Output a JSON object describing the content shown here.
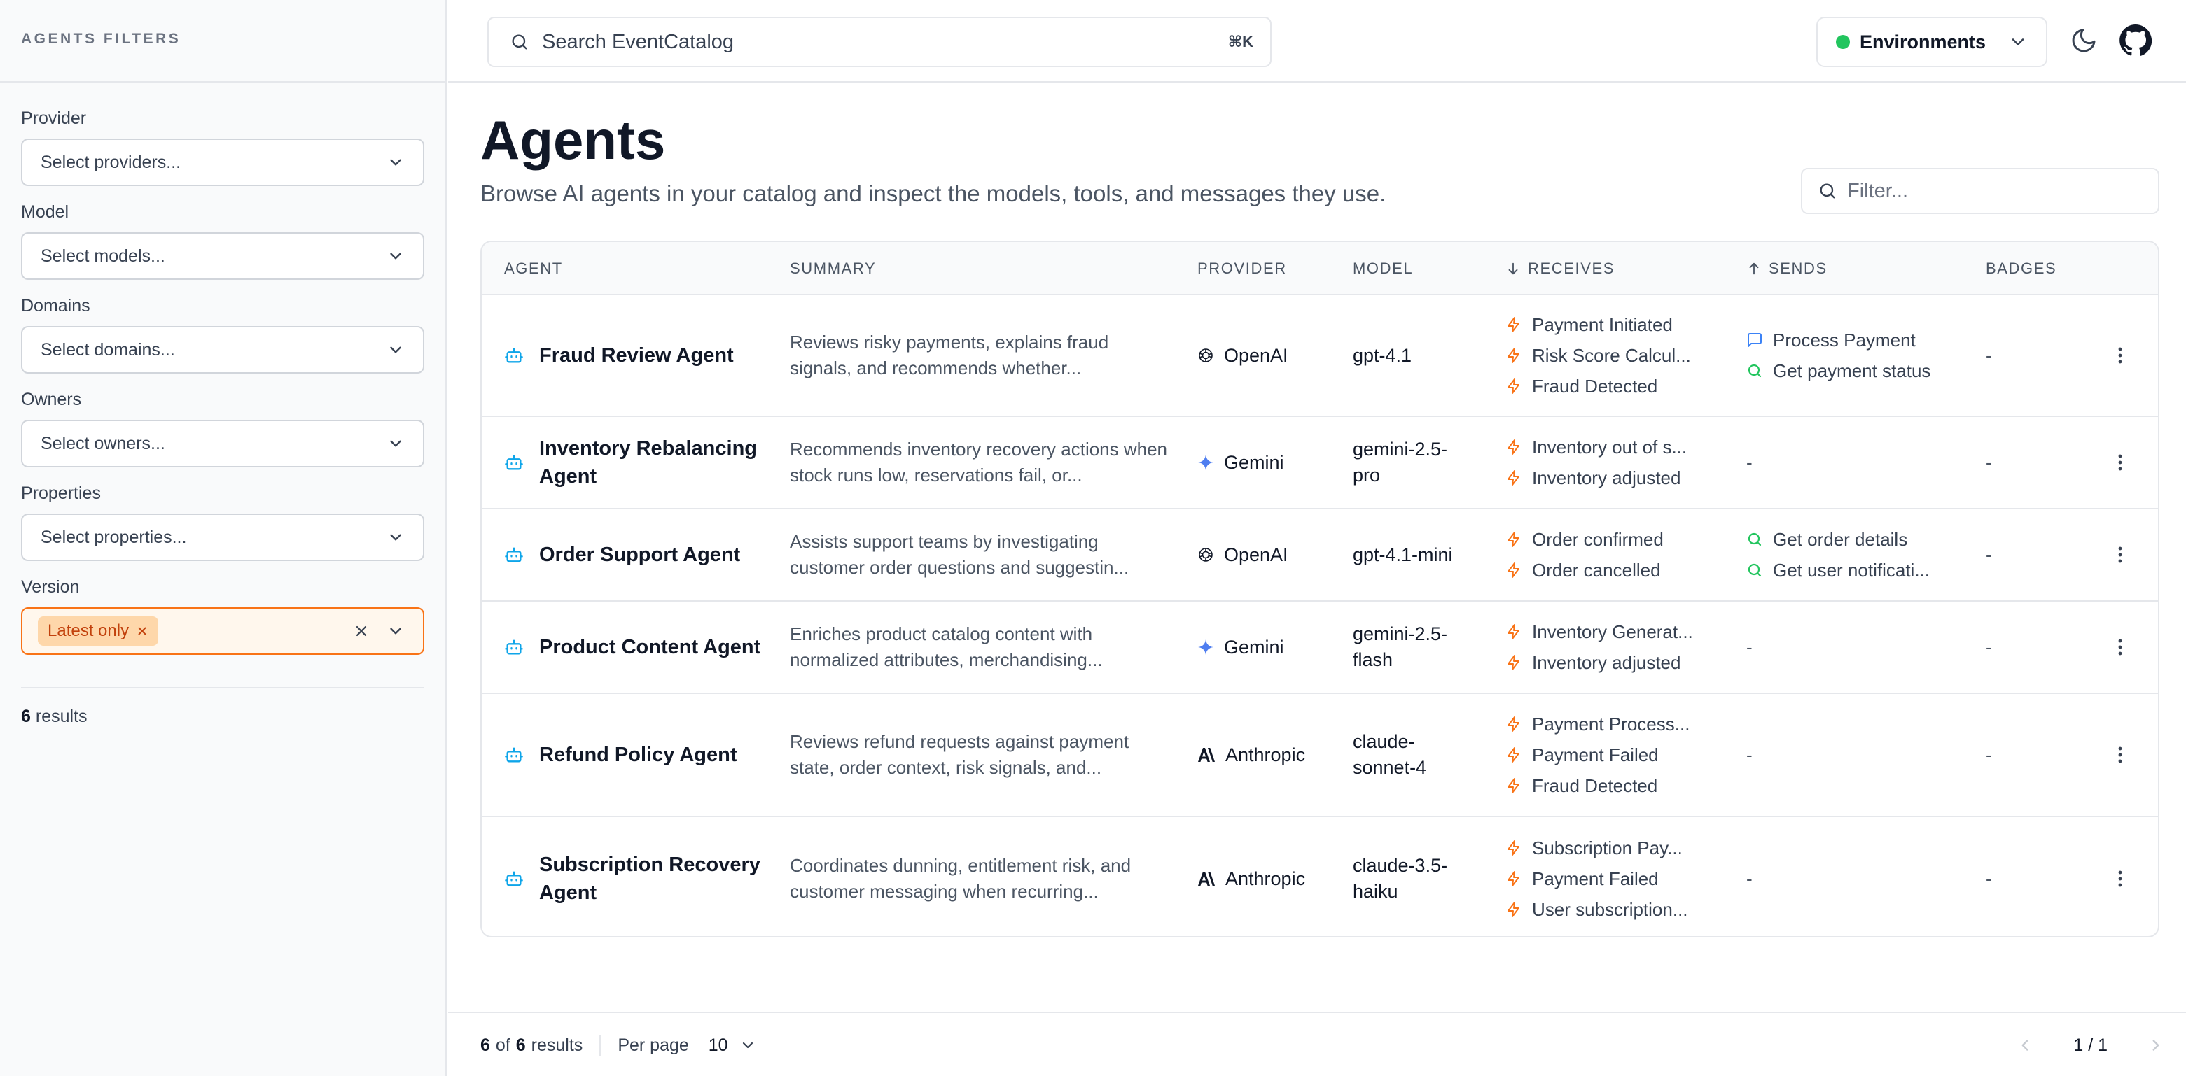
{
  "sidebar": {
    "title": "AGENTS FILTERS",
    "filters": [
      {
        "label": "Provider",
        "placeholder": "Select providers..."
      },
      {
        "label": "Model",
        "placeholder": "Select models..."
      },
      {
        "label": "Domains",
        "placeholder": "Select domains..."
      },
      {
        "label": "Owners",
        "placeholder": "Select owners..."
      },
      {
        "label": "Properties",
        "placeholder": "Select properties..."
      }
    ],
    "version": {
      "label": "Version",
      "chip": "Latest only"
    },
    "results": {
      "count": "6",
      "label": "results"
    }
  },
  "topbar": {
    "search_placeholder": "Search EventCatalog",
    "shortcut": "⌘K",
    "environments_label": "Environments",
    "env_status_color": "#22c55e"
  },
  "page": {
    "title": "Agents",
    "subtitle": "Browse AI agents in your catalog and inspect the models, tools, and messages they use.",
    "filter_placeholder": "Filter..."
  },
  "table": {
    "columns": {
      "agent": "AGENT",
      "summary": "SUMMARY",
      "provider": "PROVIDER",
      "model": "MODEL",
      "receives": "RECEIVES",
      "sends": "SENDS",
      "badges": "BADGES"
    },
    "rows": [
      {
        "name": "Fraud Review Agent",
        "summary": "Reviews risky payments, explains fraud signals, and recommends whether...",
        "provider": "OpenAI",
        "provider_icon": "openai-icon",
        "model": "gpt-4.1",
        "receives": [
          "Payment Initiated",
          "Risk Score Calcul...",
          "Fraud Detected"
        ],
        "sends": [
          {
            "label": "Process Payment",
            "kind": "command"
          },
          {
            "label": "Get payment status",
            "kind": "query"
          }
        ],
        "badges": "-"
      },
      {
        "name": "Inventory Rebalancing Agent",
        "summary": "Recommends inventory recovery actions when stock runs low, reservations fail, or...",
        "provider": "Gemini",
        "provider_icon": "gemini-icon",
        "model": "gemini-2.5-pro",
        "receives": [
          "Inventory out of s...",
          "Inventory adjusted"
        ],
        "sends": [],
        "sends_empty": "-",
        "badges": "-"
      },
      {
        "name": "Order Support Agent",
        "summary": "Assists support teams by investigating customer order questions and suggestin...",
        "provider": "OpenAI",
        "provider_icon": "openai-icon",
        "model": "gpt-4.1-mini",
        "receives": [
          "Order confirmed",
          "Order cancelled"
        ],
        "sends": [
          {
            "label": "Get order details",
            "kind": "query"
          },
          {
            "label": "Get user notificati...",
            "kind": "query"
          }
        ],
        "badges": "-"
      },
      {
        "name": "Product Content Agent",
        "summary": "Enriches product catalog content with normalized attributes, merchandising...",
        "provider": "Gemini",
        "provider_icon": "gemini-icon",
        "model": "gemini-2.5-flash",
        "receives": [
          "Inventory Generat...",
          "Inventory adjusted"
        ],
        "sends": [],
        "sends_empty": "-",
        "badges": "-"
      },
      {
        "name": "Refund Policy Agent",
        "summary": "Reviews refund requests against payment state, order context, risk signals, and...",
        "provider": "Anthropic",
        "provider_icon": "anthropic-icon",
        "model": "claude-sonnet-4",
        "receives": [
          "Payment Process...",
          "Payment Failed",
          "Fraud Detected"
        ],
        "sends": [],
        "sends_empty": "-",
        "badges": "-"
      },
      {
        "name": "Subscription Recovery Agent",
        "summary": "Coordinates dunning, entitlement risk, and customer messaging when recurring...",
        "provider": "Anthropic",
        "provider_icon": "anthropic-icon",
        "model": "claude-3.5-haiku",
        "receives": [
          "Subscription Pay...",
          "Payment Failed",
          "User subscription..."
        ],
        "sends": [],
        "sends_empty": "-",
        "badges": "-"
      }
    ]
  },
  "footer": {
    "shown": "6",
    "of_label": "of",
    "total": "6",
    "results_label": "results",
    "per_page_label": "Per page",
    "per_page_value": "10",
    "page_indicator": "1 / 1"
  },
  "colors": {
    "event": "#f97316",
    "command": "#3b82f6",
    "query": "#22c55e",
    "agent_icon": "#0ea5e9"
  }
}
